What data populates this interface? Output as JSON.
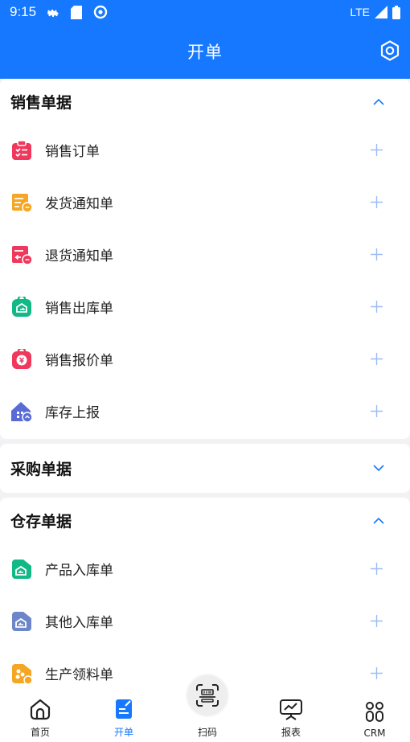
{
  "status_bar": {
    "time": "9:15",
    "network": "LTE"
  },
  "header": {
    "title": "开单"
  },
  "sections": [
    {
      "title": "销售单据",
      "expanded": true,
      "items": [
        {
          "label": "销售订单",
          "icon": "sales-order-icon",
          "color": "#f0375c"
        },
        {
          "label": "发货通知单",
          "icon": "shipping-notice-icon",
          "color": "#f5a623"
        },
        {
          "label": "退货通知单",
          "icon": "return-notice-icon",
          "color": "#f0375c"
        },
        {
          "label": "销售出库单",
          "icon": "sales-outbound-icon",
          "color": "#12b886"
        },
        {
          "label": "销售报价单",
          "icon": "sales-quote-icon",
          "color": "#f0375c"
        },
        {
          "label": "库存上报",
          "icon": "inventory-report-icon",
          "color": "#5b6bd6"
        }
      ]
    },
    {
      "title": "采购单据",
      "expanded": false,
      "items": []
    },
    {
      "title": "仓存单据",
      "expanded": true,
      "items": [
        {
          "label": "产品入库单",
          "icon": "product-inbound-icon",
          "color": "#12b886"
        },
        {
          "label": "其他入库单",
          "icon": "other-inbound-icon",
          "color": "#6c86c7"
        },
        {
          "label": "生产领料单",
          "icon": "material-requisition-icon",
          "color": "#f5a623"
        }
      ]
    }
  ],
  "tabbar": {
    "tabs": [
      {
        "label": "首页",
        "icon": "home-icon",
        "active": false
      },
      {
        "label": "开单",
        "icon": "document-edit-icon",
        "active": true
      },
      {
        "label": "扫码",
        "icon": "scan-icon",
        "active": false
      },
      {
        "label": "报表",
        "icon": "report-icon",
        "active": false
      },
      {
        "label": "CRM",
        "icon": "crm-icon",
        "active": false
      }
    ]
  },
  "colors": {
    "primary": "#1677ff",
    "accent_icon": "#9bbcf5",
    "background": "#f2f2f4"
  }
}
